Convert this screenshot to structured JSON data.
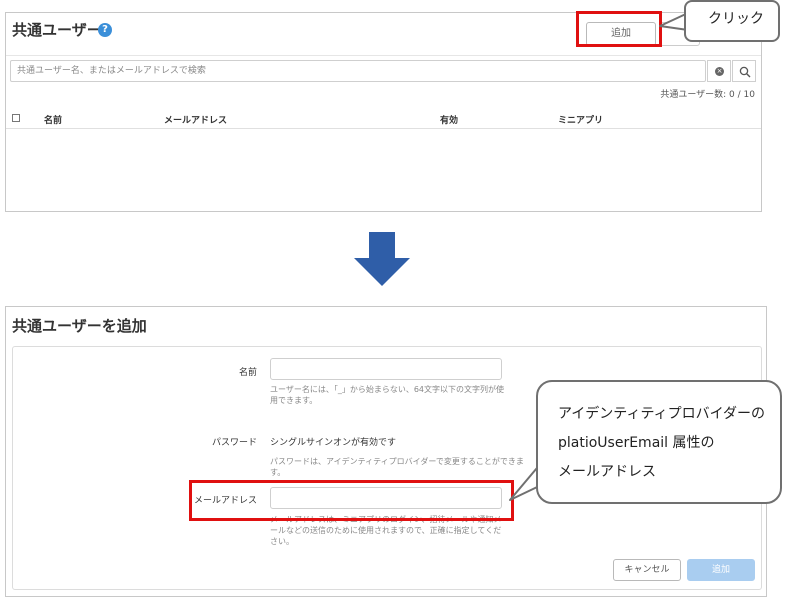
{
  "top": {
    "title": "共通ユーザー",
    "help": "?",
    "add_button": "追加",
    "delete_button": "削",
    "search_placeholder": "共通ユーザー名、またはメールアドレスで検索",
    "count_text": "共通ユーザー数: 0 / 10",
    "columns": [
      "名前",
      "メールアドレス",
      "有効",
      "ミニアプリ"
    ]
  },
  "dialog": {
    "title": "共通ユーザーを追加",
    "name_label": "名前",
    "name_value": "",
    "name_hint": "ユーザー名には、「_」から始まらない、64文字以下の文字列が使用できます。",
    "password_label": "パスワード",
    "password_value": "シングルサインオンが有効です",
    "password_hint": "パスワードは、アイデンティティプロバイダーで変更することができます。",
    "email_label": "メールアドレス",
    "email_value": "",
    "email_hint": "メールアドレスは、ミニアプリのログイン、招待メールや通知メールなどの送信のために使用されますので、正確に指定してください。",
    "cancel_button": "キャンセル",
    "submit_button": "追加"
  },
  "annotations": {
    "click_callout": "クリック",
    "attr_line1": "アイデンティティプロバイダーの",
    "attr_line2": "platioUserEmail 属性の",
    "attr_line3": "メールアドレス",
    "highlight_color": "#e01010",
    "arrow_color": "#2f5ea8"
  }
}
